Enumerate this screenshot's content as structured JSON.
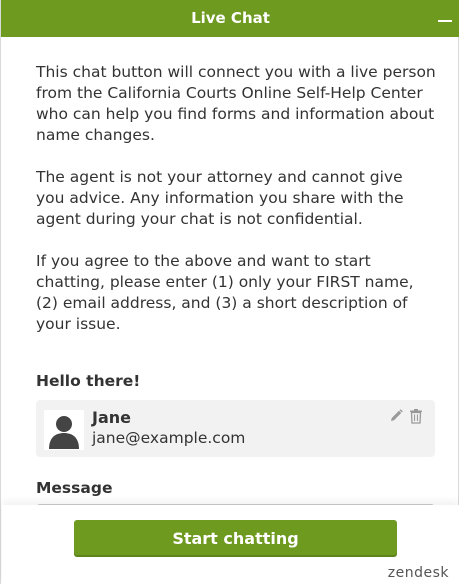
{
  "header": {
    "title": "Live Chat",
    "minimize_icon": "minus-icon"
  },
  "intro": {
    "paragraphs": [
      "This chat button will connect you with a live person from the California Courts Online Self-Help Center who can help you find forms and information about name changes.",
      "The agent is not your attorney and cannot give you advice.  Any information you share with the agent during your chat is not confidential.",
      "If you agree to the above and want to start chatting, please enter (1) only your FIRST name, (2) email address, and (3) a short description of your issue."
    ]
  },
  "greeting": {
    "label": "Hello there!"
  },
  "user": {
    "name": "Jane",
    "email": "jane@example.com",
    "avatar_icon": "person-icon",
    "edit_icon": "pencil-icon",
    "delete_icon": "trash-icon"
  },
  "message": {
    "label": "Message",
    "value": ""
  },
  "footer": {
    "start_label": "Start chatting",
    "brand": "zendesk"
  },
  "colors": {
    "accent": "#6e9a1f",
    "card_bg": "#f2f2f2",
    "text": "#333333"
  }
}
